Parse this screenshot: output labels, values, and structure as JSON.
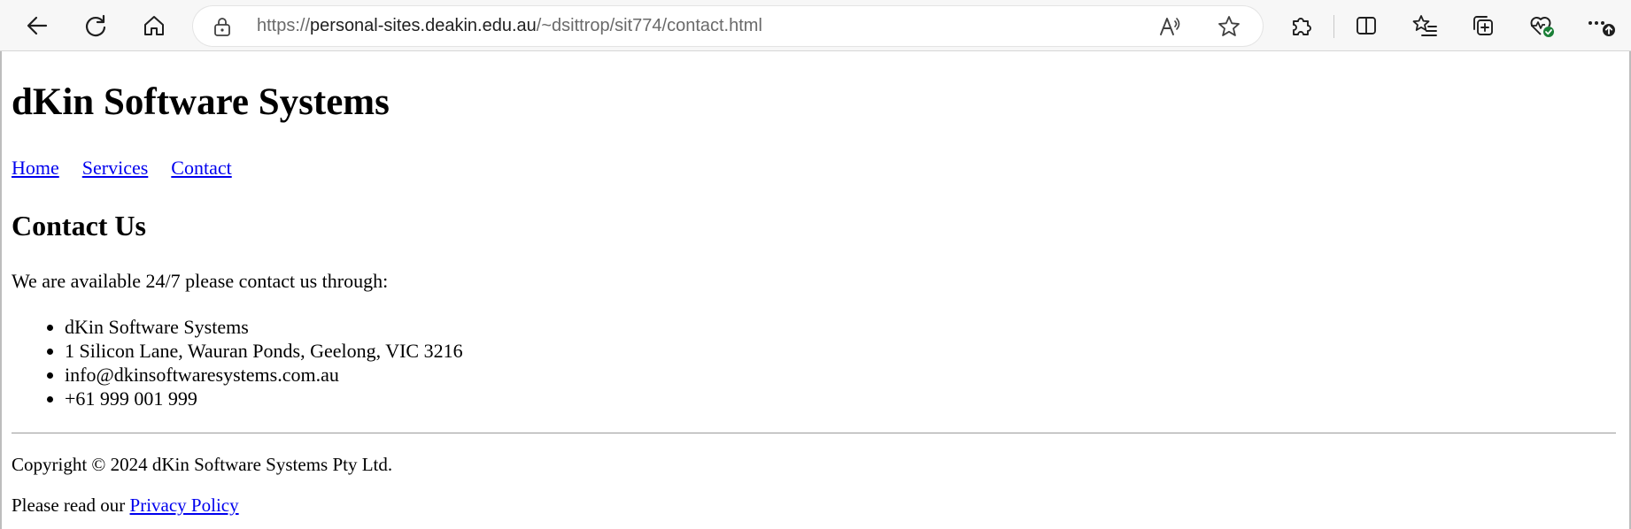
{
  "browser": {
    "url_scheme": "https://",
    "url_host": "personal-sites.deakin.edu.au",
    "url_path": "/~dsittrop/sit774/contact.html",
    "icons": {
      "back": "back-arrow-icon",
      "refresh": "refresh-icon",
      "home": "home-icon",
      "lock": "lock-icon",
      "read_aloud": "read-aloud-icon",
      "favorite": "star-icon",
      "extensions": "puzzle-icon",
      "split_screen": "split-screen-icon",
      "favorites": "favorites-list-icon",
      "collections": "collections-icon",
      "browser_essentials": "heartbeat-icon",
      "more": "more-icon"
    },
    "accent_color": "#1a7f37"
  },
  "page": {
    "site_title": "dKin Software Systems",
    "nav": {
      "home": "Home",
      "services": "Services",
      "contact": "Contact"
    },
    "section_title": "Contact Us",
    "intro": "We are available 24/7 please contact us through:",
    "contact_items": [
      "dKin Software Systems",
      "1 Silicon Lane, Wauran Ponds, Geelong, VIC 3216",
      "info@dkinsoftwaresystems.com.au",
      "+61 999 001 999"
    ],
    "copyright": "Copyright © 2024 dKin Software Systems Pty Ltd.",
    "privacy_prefix": "Please read our ",
    "privacy_link": "Privacy Policy",
    "link_color": "#0000ee"
  }
}
